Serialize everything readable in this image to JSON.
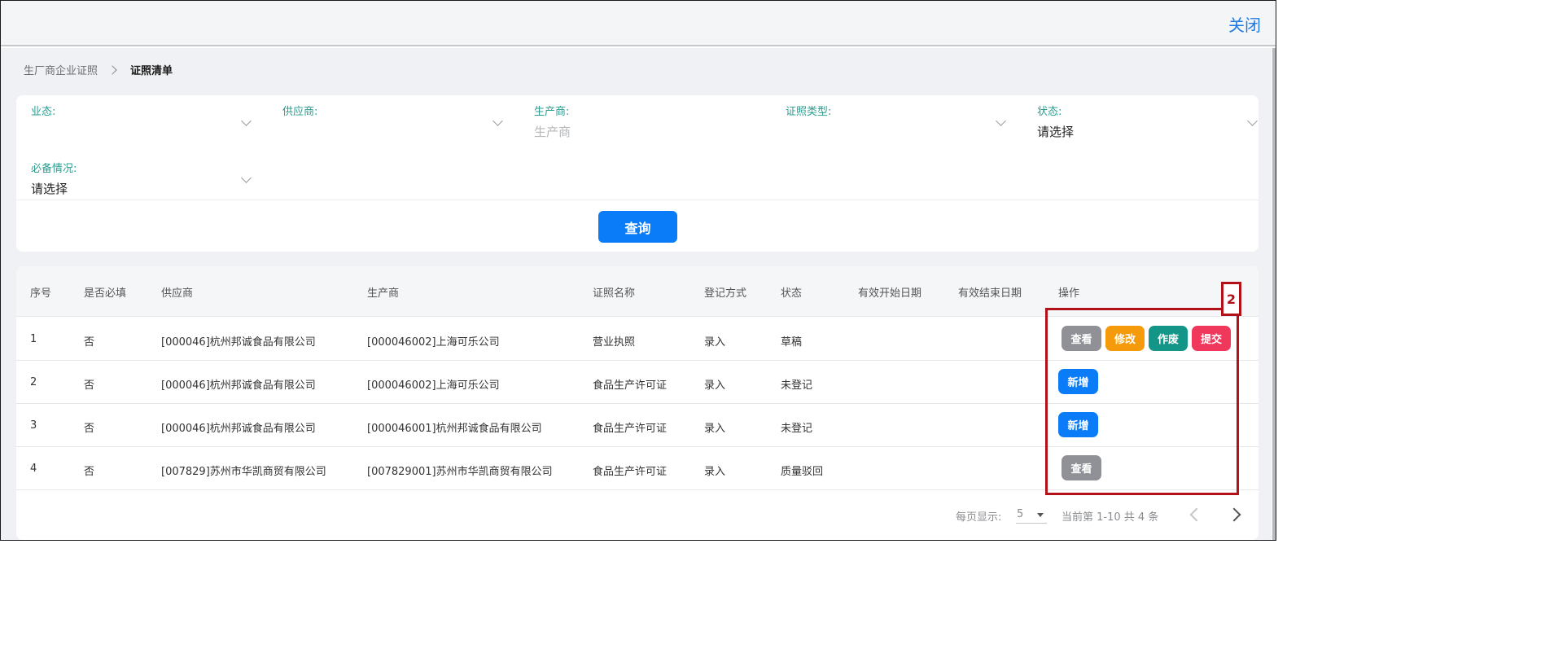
{
  "header": {
    "close_label": "关闭"
  },
  "breadcrumb": {
    "parent": "生厂商企业证照",
    "current": "证照清单"
  },
  "filters": {
    "business_type": {
      "label": "业态:",
      "value": ""
    },
    "supplier": {
      "label": "供应商:",
      "value": ""
    },
    "manufacturer": {
      "label": "生产商:",
      "placeholder": "生产商"
    },
    "license_type": {
      "label": "证照类型:",
      "value": ""
    },
    "status": {
      "label": "状态:",
      "value": "请选择"
    },
    "required": {
      "label": "必备情况:",
      "value": "请选择"
    }
  },
  "query_button": "查询",
  "table": {
    "columns": [
      "序号",
      "是否必填",
      "供应商",
      "生产商",
      "证照名称",
      "登记方式",
      "状态",
      "有效开始日期",
      "有效结束日期",
      "操作"
    ],
    "rows": [
      {
        "seq": "1",
        "required": "否",
        "supplier": "[000046]杭州邦诚食品有限公司",
        "manufacturer": "[000046002]上海可乐公司",
        "license": "营业执照",
        "method": "录入",
        "status": "草稿",
        "start": "",
        "end": "",
        "actions": [
          "查看",
          "修改",
          "作废",
          "提交"
        ]
      },
      {
        "seq": "2",
        "required": "否",
        "supplier": "[000046]杭州邦诚食品有限公司",
        "manufacturer": "[000046002]上海可乐公司",
        "license": "食品生产许可证",
        "method": "录入",
        "status": "未登记",
        "start": "",
        "end": "",
        "actions": [
          "新增"
        ]
      },
      {
        "seq": "3",
        "required": "否",
        "supplier": "[000046]杭州邦诚食品有限公司",
        "manufacturer": "[000046001]杭州邦诚食品有限公司",
        "license": "食品生产许可证",
        "method": "录入",
        "status": "未登记",
        "start": "",
        "end": "",
        "actions": [
          "新增"
        ]
      },
      {
        "seq": "4",
        "required": "否",
        "supplier": "[007829]苏州市华凯商贸有限公司",
        "manufacturer": "[007829001]苏州市华凯商贸有限公司",
        "license": "食品生产许可证",
        "method": "录入",
        "status": "质量驳回",
        "start": "",
        "end": "",
        "actions": [
          "查看"
        ]
      }
    ]
  },
  "pagination": {
    "per_page_label": "每页显示:",
    "per_page_value": "5",
    "info": "当前第 1-10 共 4 条"
  },
  "annotation": {
    "label": "2",
    "color": "#b2111a"
  },
  "colors": {
    "primary": "#0a7cf7",
    "view": "#8f9196",
    "edit": "#f59a0b",
    "void": "#139687",
    "submit": "#f0385c",
    "label_teal": "#2a9d8f"
  }
}
